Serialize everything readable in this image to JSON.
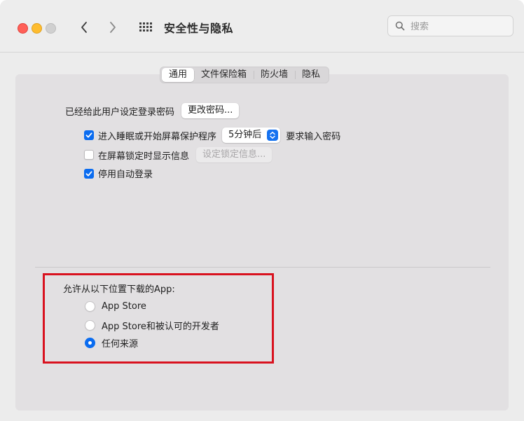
{
  "window": {
    "title": "安全性与隐私",
    "search_placeholder": "搜索"
  },
  "tabs": [
    {
      "label": "通用",
      "active": true
    },
    {
      "label": "文件保险箱",
      "active": false
    },
    {
      "label": "防火墙",
      "active": false
    },
    {
      "label": "隐私",
      "active": false
    }
  ],
  "general": {
    "password_set_label": "已经给此用户设定登录密码",
    "change_password_button": "更改密码...",
    "require_password": {
      "checked": true,
      "label": "进入睡眠或开始屏幕保护程序",
      "delay_value": "5分钟后",
      "suffix": "要求输入密码"
    },
    "show_message": {
      "checked": false,
      "label": "在屏幕锁定时显示信息",
      "button": "设定锁定信息..."
    },
    "disable_autologin": {
      "checked": true,
      "label": "停用自动登录"
    }
  },
  "downloads": {
    "heading": "允许从以下位置下载的App:",
    "options": [
      {
        "label": "App Store",
        "selected": false
      },
      {
        "label": "App Store和被认可的开发者",
        "selected": false
      },
      {
        "label": "任何来源",
        "selected": true
      }
    ]
  },
  "colors": {
    "accent": "#0a6cf0",
    "highlight_border": "#d9121f"
  }
}
